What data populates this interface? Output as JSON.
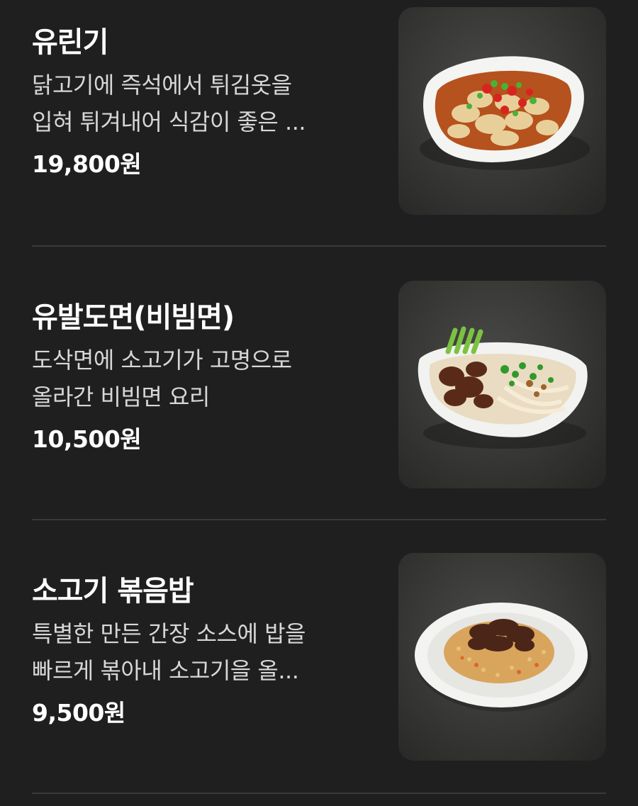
{
  "menu": {
    "items": [
      {
        "name": "유린기",
        "desc_line1": "닭고기에 즉석에서 튀김옷을",
        "desc_line2": "입혀 튀겨내어 식감이 좋은 ...",
        "price": "19,800원",
        "image_icon": "fried-chicken-dish-icon"
      },
      {
        "name": "유발도면(비빔면)",
        "desc_line1": "도삭면에 소고기가 고명으로",
        "desc_line2": "올라간 비빔면 요리",
        "price": "10,500원",
        "image_icon": "noodle-bowl-icon"
      },
      {
        "name": "소고기 볶음밥",
        "desc_line1": "특별한 만든 간장 소스에 밥을",
        "desc_line2": "빠르게 볶아내 소고기을 올...",
        "price": "9,500원",
        "image_icon": "fried-rice-plate-icon"
      }
    ]
  },
  "colors": {
    "background": "#1f1f20",
    "divider": "#3a3a3b",
    "title_text": "#ffffff",
    "desc_text": "#d7d7d7"
  }
}
